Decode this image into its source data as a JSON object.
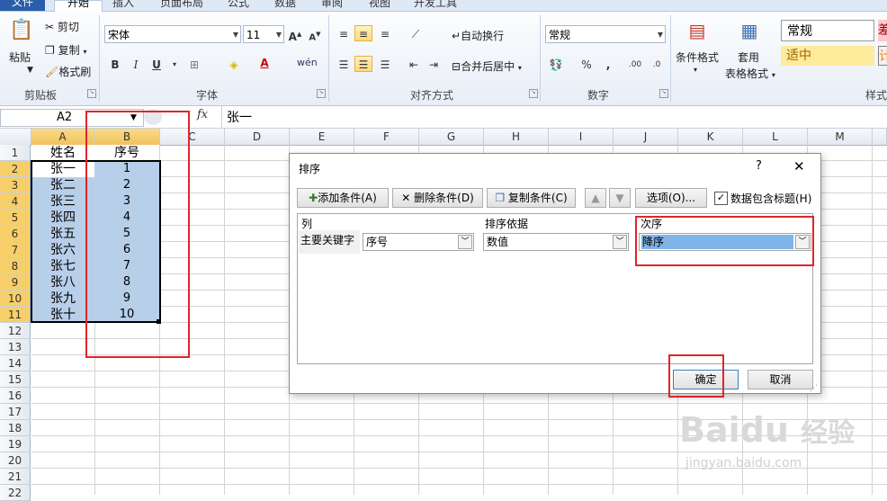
{
  "tabs": [
    "文件",
    "开始",
    "插入",
    "页面布局",
    "公式",
    "数据",
    "审阅",
    "视图",
    "开发工具"
  ],
  "ribbon": {
    "clipboard": {
      "paste": "粘贴",
      "cut": "剪切",
      "copy": "复制",
      "format_painter": "格式刷",
      "label": "剪贴板"
    },
    "font": {
      "font_name": "宋体",
      "font_size": "11",
      "bold": "B",
      "italic": "I",
      "underline": "U",
      "label": "字体"
    },
    "alignment": {
      "wrap_text": "自动换行",
      "merge_center": "合并后居中",
      "label": "对齐方式"
    },
    "number": {
      "format": "常规",
      "percent": "%",
      "comma": ",",
      "label": "数字"
    },
    "styles": {
      "conditional_format": "条件格式",
      "table_format_line1": "套用",
      "table_format_line2": "表格格式",
      "style_normal": "常规",
      "style_neutral": "适中",
      "style_bad": "差",
      "style_calc": "计",
      "label": "样式"
    }
  },
  "formula_bar": {
    "name_box": "A2",
    "fx": "fx",
    "content": "张一"
  },
  "columns": [
    "A",
    "B",
    "C",
    "D",
    "E",
    "F",
    "G",
    "H",
    "I",
    "J",
    "K",
    "L",
    "M"
  ],
  "rows": [
    "1",
    "2",
    "3",
    "4",
    "5",
    "6",
    "7",
    "8",
    "9",
    "10",
    "11",
    "12",
    "13",
    "14",
    "15",
    "16",
    "17",
    "18",
    "19",
    "20",
    "21",
    "22"
  ],
  "sheet": {
    "header": [
      "姓名",
      "序号"
    ],
    "data": [
      [
        "张一",
        "1"
      ],
      [
        "张二",
        "2"
      ],
      [
        "张三",
        "3"
      ],
      [
        "张四",
        "4"
      ],
      [
        "张五",
        "5"
      ],
      [
        "张六",
        "6"
      ],
      [
        "张七",
        "7"
      ],
      [
        "张八",
        "8"
      ],
      [
        "张九",
        "9"
      ],
      [
        "张十",
        "10"
      ]
    ]
  },
  "dialog": {
    "title": "排序",
    "help": "?",
    "close": "✕",
    "add_level": "添加条件(A)",
    "delete_level": "删除条件(D)",
    "copy_level": "复制条件(C)",
    "options": "选项(O)...",
    "has_headers": "数据包含标题(H)",
    "has_headers_checked": true,
    "col_header": "列",
    "sort_on_header": "排序依据",
    "order_header": "次序",
    "row_label": "主要关键字",
    "key_value": "序号",
    "sort_on_value": "数值",
    "order_value": "降序",
    "ok": "确定",
    "cancel": "取消"
  },
  "watermark": {
    "brand": "Baidu",
    "brand_cn": "经验",
    "url": "jingyan.baidu.com"
  },
  "colors": {
    "selection": "#b8cfe9",
    "annotation_red": "#e0242b",
    "file_tab": "#2a5eab"
  }
}
